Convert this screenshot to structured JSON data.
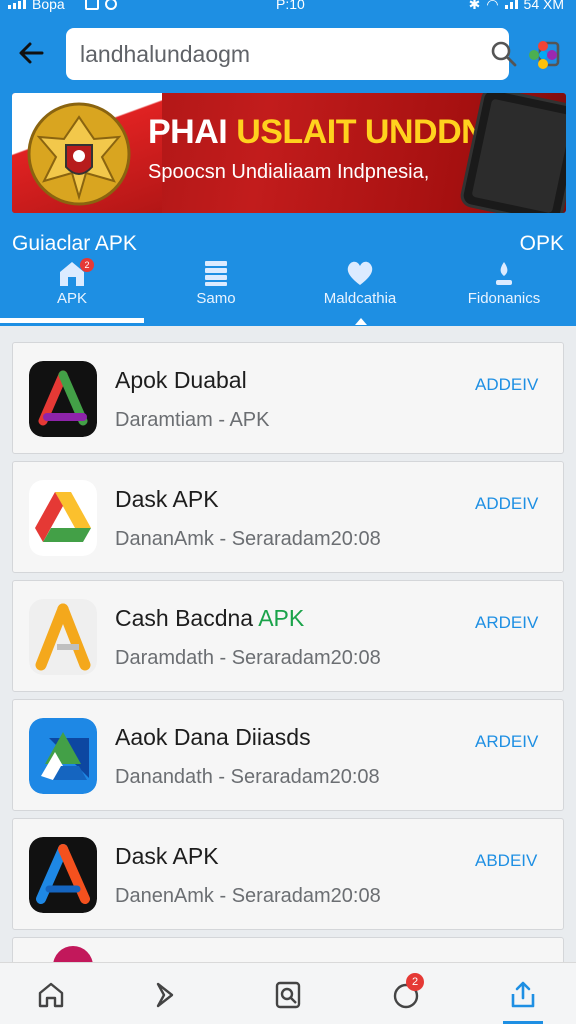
{
  "status_bar": {
    "carrier": "Bopa",
    "time": "P:10",
    "right_text": "54 XM"
  },
  "search": {
    "value": "landhalundaogm",
    "placeholder": ""
  },
  "banner": {
    "title_white": "PHAI",
    "title_accent": "USLAIT UNDDNEAIN",
    "subtitle": "Spoocsn Undialiaam Indpnesia,"
  },
  "section": {
    "left_label": "Guiaclar APK",
    "right_label": "OPK"
  },
  "tabs": [
    {
      "label": "APK",
      "icon": "home-icon",
      "badge": "2",
      "active": true
    },
    {
      "label": "Samo",
      "icon": "stack-icon",
      "active": false
    },
    {
      "label": "Maldcathia",
      "icon": "heart-icon",
      "active": false
    },
    {
      "label": "Fidonanics",
      "icon": "person-icon",
      "active": false
    }
  ],
  "apps": [
    {
      "name": "Apok Duabal",
      "name_tag": "",
      "meta": "Daramtiam - APK",
      "action": "ADDEIV",
      "icon": "triangle-dark-icon"
    },
    {
      "name": "Dask APK",
      "name_tag": "",
      "meta": "DananAmk - Seraradam20:08",
      "action": "ADDEIV",
      "icon": "drive-icon"
    },
    {
      "name": "Cash Bacdna ",
      "name_tag": "APK",
      "meta": "Daramdath - Seraradam20:08",
      "action": "ARDEIV",
      "icon": "orange-a-icon"
    },
    {
      "name": "Aaok Dana Diiasds",
      "name_tag": "",
      "meta": "Danandath - Seraradam20:08",
      "action": "ARDEIV",
      "icon": "blue-drive-icon"
    },
    {
      "name": "Dask APK",
      "name_tag": "",
      "meta": "DanenAmk - Seraradam20:08",
      "action": "ABDEIV",
      "icon": "triangle-blue-icon"
    }
  ],
  "bottom_nav": [
    {
      "icon": "home-icon",
      "active": false
    },
    {
      "icon": "tag-icon",
      "active": false
    },
    {
      "icon": "search-doc-icon",
      "active": false
    },
    {
      "icon": "notification-icon",
      "badge": "2",
      "active": false
    },
    {
      "icon": "share-icon",
      "active": true
    }
  ],
  "colors": {
    "primary": "#1e8fe3",
    "banner_red": "#c21c1c",
    "accent_yellow": "#ffd21e",
    "tag_green": "#1aa34a"
  }
}
